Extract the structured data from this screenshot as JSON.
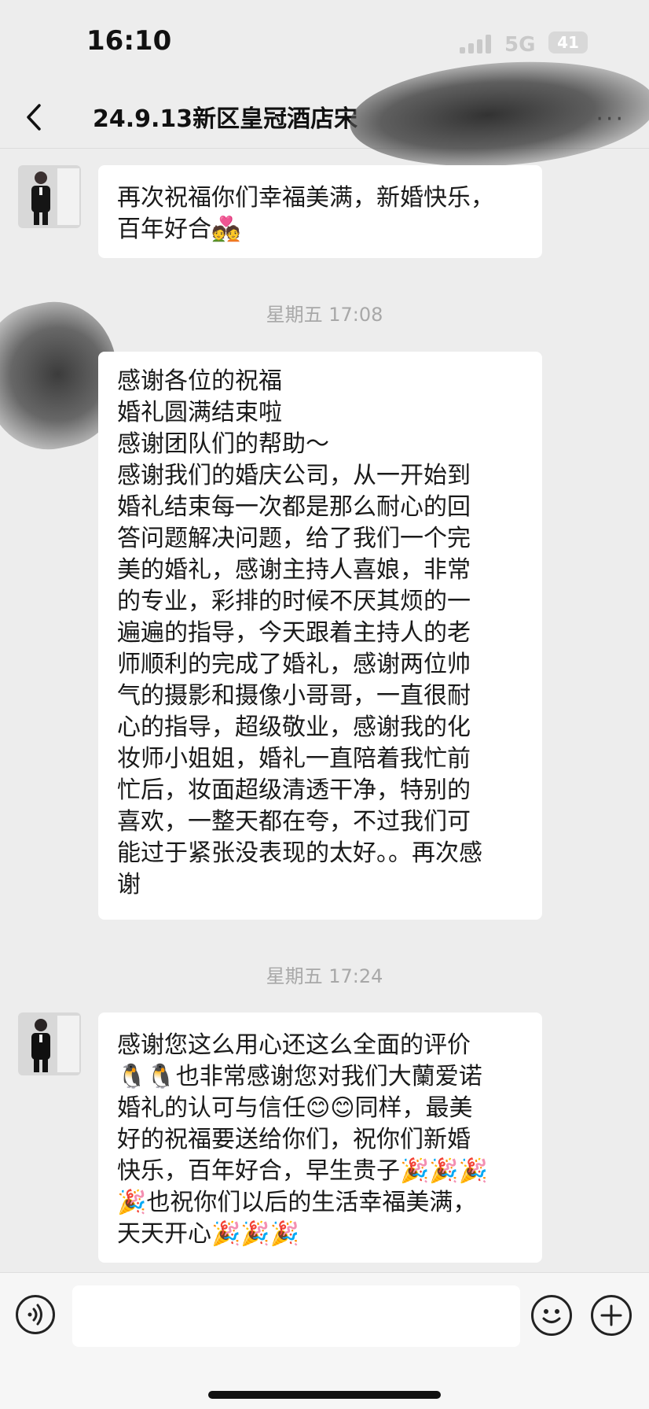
{
  "status_bar": {
    "time": "16:10",
    "network": "5G",
    "battery": "41"
  },
  "nav": {
    "title": "24.9.13新区皇冠酒店宋",
    "more": "···"
  },
  "messages": [
    {
      "lines": [
        "再次祝福你们幸福美满，新婚快乐，",
        "百年好合💑"
      ]
    },
    {
      "timestamp": "星期五 17:08",
      "lines": [
        "感谢各位的祝福",
        "婚礼圆满结束啦",
        "感谢团队们的帮助～",
        "感谢我们的婚庆公司，从一开始到",
        "婚礼结束每一次都是那么耐心的回",
        "答问题解决问题，给了我们一个完",
        "美的婚礼，感谢主持人喜娘，非常",
        "的专业，彩排的时候不厌其烦的一",
        "遍遍的指导，今天跟着主持人的老",
        "师顺利的完成了婚礼，感谢两位帅",
        "气的摄影和摄像小哥哥，一直很耐",
        "心的指导，超级敬业，感谢我的化",
        "妆师小姐姐，婚礼一直陪着我忙前",
        "忙后，妆面超级清透干净，特别的",
        "喜欢，一整天都在夸，不过我们可",
        "能过于紧张没表现的太好。。再次感",
        "谢"
      ]
    },
    {
      "timestamp": "星期五 17:24",
      "lines": [
        "感谢您这么用心还这么全面的评价",
        "🐧🐧也非常感谢您对我们大蘭爱诺",
        "婚礼的认可与信任😊😊同样，最美",
        "好的祝福要送给你们，祝你们新婚",
        "快乐，百年好合，早生贵子🎉🎉🎉",
        "🎉也祝你们以后的生活幸福美满，",
        "天天开心🎉🎉🎉"
      ]
    }
  ],
  "input": {
    "placeholder": ""
  },
  "icons": {
    "back": "chevron-left-icon",
    "voice": "voice-icon",
    "emoji": "emoji-icon",
    "plus": "plus-icon"
  }
}
